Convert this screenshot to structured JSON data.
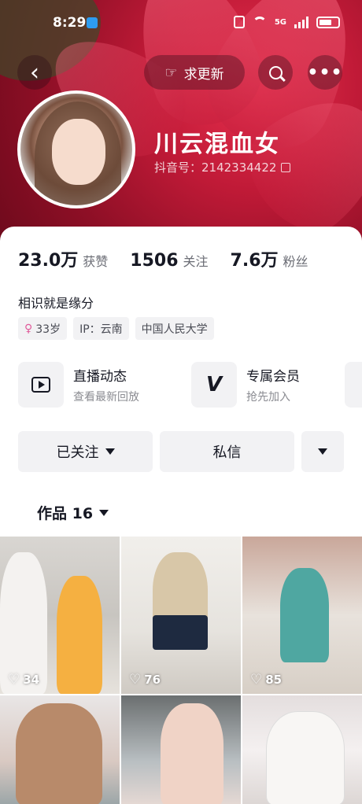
{
  "status_bar": {
    "time": "8:29",
    "network": "5G"
  },
  "top_nav": {
    "update_label": "求更新"
  },
  "profile": {
    "name": "川云混血女",
    "douyin_id": "抖音号：2142334422"
  },
  "stats": [
    {
      "value": "23.0万",
      "label": "获赞"
    },
    {
      "value": "1506",
      "label": "关注"
    },
    {
      "value": "7.6万",
      "label": "粉丝"
    }
  ],
  "bio": "相识就是缘分",
  "tags": [
    {
      "icon": "female-icon",
      "text": "33岁"
    },
    {
      "text": "IP：云南"
    },
    {
      "text": "中国人民大学"
    }
  ],
  "features": [
    {
      "icon": "tv-icon",
      "title": "直播动态",
      "subtitle": "查看最新回放"
    },
    {
      "icon": "vip-icon",
      "title": "专属会员",
      "subtitle": "抢先加入"
    }
  ],
  "actions": {
    "followed_label": "已关注",
    "message_label": "私信"
  },
  "works_tab": {
    "label": "作品 16"
  },
  "videos": [
    {
      "likes": "34"
    },
    {
      "likes": "76"
    },
    {
      "likes": "85"
    },
    {},
    {},
    {}
  ],
  "colors": {
    "banner": "#c01a37",
    "button_bg": "#f2f2f4",
    "text_primary": "#161823",
    "text_secondary": "#8a8b91"
  }
}
